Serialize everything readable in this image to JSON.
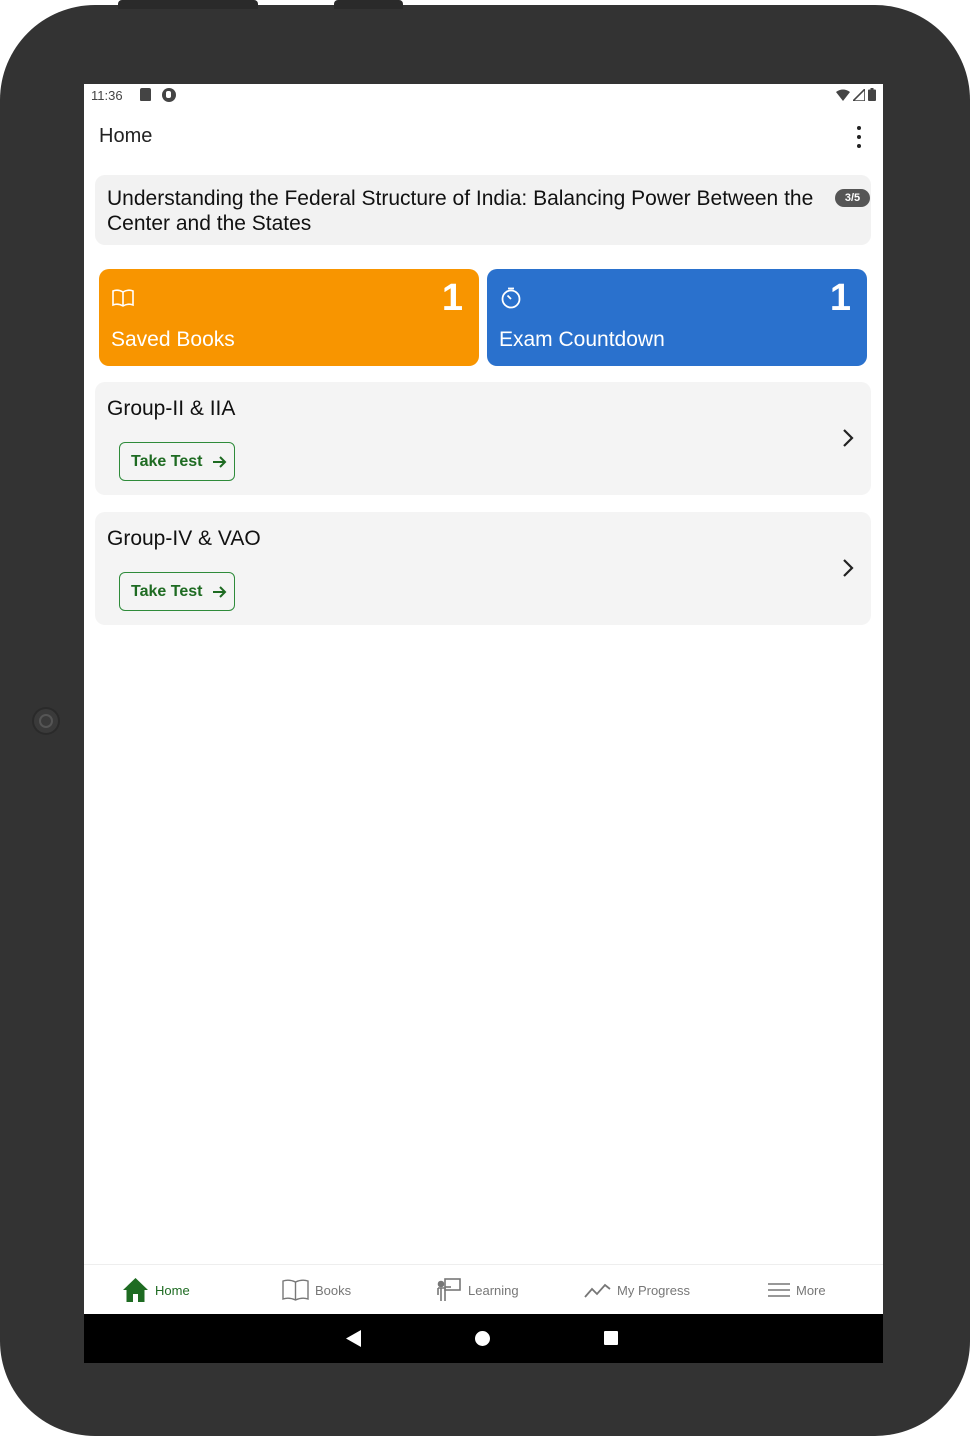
{
  "status_bar": {
    "time": "11:36"
  },
  "app_bar": {
    "title": "Home"
  },
  "banner": {
    "text": "Understanding the Federal Structure of India: Balancing Power Between the Center and the States",
    "badge": "3/5"
  },
  "tiles": [
    {
      "label": "Saved Books",
      "count": "1",
      "color": "#f89500",
      "icon": "book-open-icon"
    },
    {
      "label": "Exam Countdown",
      "count": "1",
      "color": "#2a71cd",
      "icon": "timer-icon"
    }
  ],
  "groups": [
    {
      "title": "Group-II & IIA",
      "button": "Take Test"
    },
    {
      "title": "Group-IV & VAO",
      "button": "Take Test"
    }
  ],
  "bottom_nav": [
    {
      "label": "Home",
      "icon": "home-icon",
      "active": true
    },
    {
      "label": "Books",
      "icon": "book-icon",
      "active": false
    },
    {
      "label": "Learning",
      "icon": "teacher-board-icon",
      "active": false
    },
    {
      "label": "My Progress",
      "icon": "trend-line-icon",
      "active": false
    },
    {
      "label": "More",
      "icon": "hamburger-menu-icon",
      "active": false
    }
  ],
  "colors": {
    "accent_green": "#1e6b22",
    "tile_orange": "#f89500",
    "tile_blue": "#2a71cd"
  }
}
